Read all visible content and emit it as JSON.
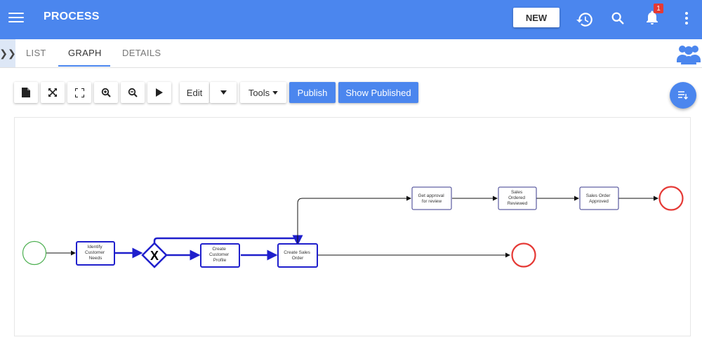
{
  "header": {
    "title": "PROCESS",
    "new_label": "NEW",
    "notification_count": "1",
    "color": "#4b86ee"
  },
  "tabs": [
    {
      "label": "LIST"
    },
    {
      "label": "GRAPH",
      "active": true
    },
    {
      "label": "DETAILS"
    }
  ],
  "toolbar": {
    "edit_label": "Edit",
    "tools_label": "Tools",
    "publish_label": "Publish",
    "show_published_label": "Show Published",
    "icons": [
      "file-icon",
      "expand-icon",
      "fullscreen-icon",
      "zoom-in-icon",
      "zoom-out-icon",
      "play-icon"
    ]
  },
  "diagram": {
    "nodes": [
      {
        "id": "identify",
        "lines": [
          "Identify",
          "Customer",
          "Needs"
        ]
      },
      {
        "id": "create_profile",
        "lines": [
          "Create",
          "Customer",
          "Profile"
        ]
      },
      {
        "id": "create_sales_order",
        "lines": [
          "Create Sales",
          "Order"
        ]
      },
      {
        "id": "get_approval",
        "lines": [
          "Get approval",
          "for review"
        ]
      },
      {
        "id": "sales_reviewed",
        "lines": [
          "Sales",
          "Ordered",
          "Reviewed"
        ]
      },
      {
        "id": "sales_approved",
        "lines": [
          "Sales Order",
          "Approved"
        ]
      }
    ],
    "gateway_label": "X",
    "colors": {
      "start": "#4caf50",
      "end": "#e53935",
      "active": "#1f1fcc",
      "pending": "#3a3a8c"
    }
  }
}
